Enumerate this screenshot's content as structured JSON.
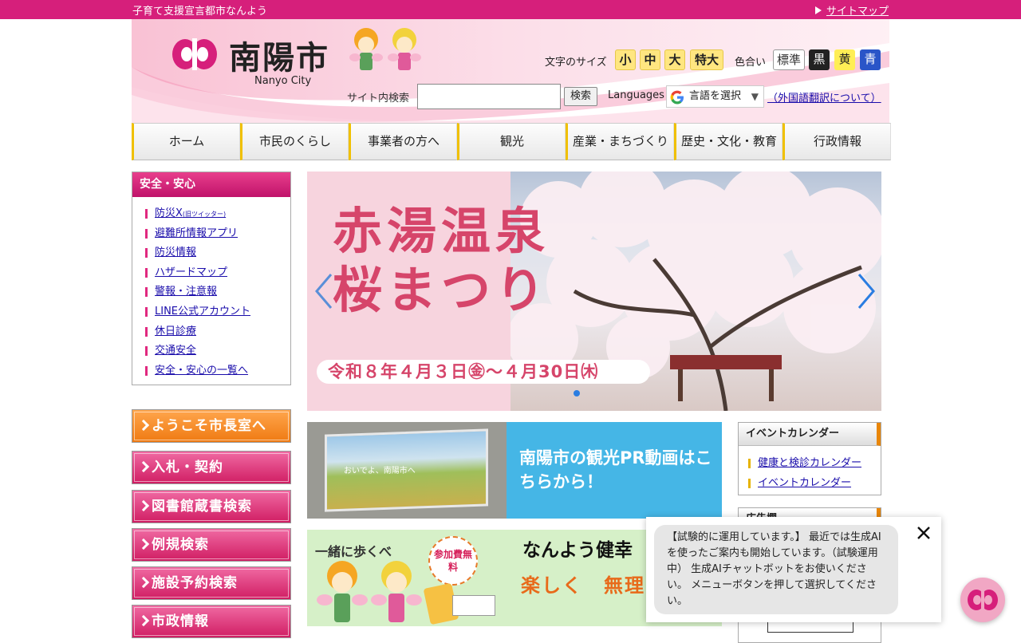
{
  "topbar": {
    "tagline": "子育て支援宣言都市なんよう",
    "sitemap": "サイトマップ"
  },
  "header": {
    "logo_jp": "南陽市",
    "logo_en": "Nanyo City",
    "text_size_label": "文字のサイズ",
    "text_sizes": [
      "小",
      "中",
      "大",
      "特大"
    ],
    "color_label": "色合い",
    "color_options": [
      {
        "label": "標準",
        "bg": "#ffffff",
        "fg": "#333333"
      },
      {
        "label": "黒",
        "bg": "#222222",
        "fg": "#ffffff"
      },
      {
        "label": "黄",
        "bg": "#ffee55",
        "fg": "#222222"
      },
      {
        "label": "青",
        "bg": "#2a55c8",
        "fg": "#ffffff"
      }
    ],
    "search_label": "サイト内検索",
    "search_placeholder": "",
    "search_button": "検索",
    "languages_label": "Languages",
    "language_select": "言語を選択",
    "translation_link": "（外国語翻訳について）"
  },
  "nav": [
    "ホーム",
    "市民のくらし",
    "事業者の方へ",
    "観光",
    "産業・まちづくり",
    "歴史・文化・教育",
    "行政情報"
  ],
  "sidebar": {
    "safety": {
      "title": "安全・安心",
      "items": [
        {
          "label": "防災X",
          "note": "(旧ツイッター)"
        },
        {
          "label": "避難所情報アプリ",
          "note": ""
        },
        {
          "label": "防災情報",
          "note": ""
        },
        {
          "label": "ハザードマップ",
          "note": ""
        },
        {
          "label": "警報・注意報",
          "note": ""
        },
        {
          "label": "LINE公式アカウント",
          "note": ""
        },
        {
          "label": "休日診療",
          "note": ""
        },
        {
          "label": "交通安全",
          "note": ""
        },
        {
          "label": "安全・安心の一覧へ",
          "note": ""
        }
      ]
    },
    "banners": [
      "ようこそ市長室へ",
      "入札・契約",
      "図書館蔵書検索",
      "例規検索",
      "施設予約検索",
      "市政情報"
    ]
  },
  "hero": {
    "title_line1": "赤湯温泉",
    "title_line2": "桜まつり",
    "date": "令和８年４月３日㊎～４月30日㈭"
  },
  "promo": {
    "pr_image_caption": "おいでよ、南陽市へ",
    "pr_text": "南陽市の観光PR動画はこちらから！",
    "health_left": "一緒に歩くべ",
    "health_badge": "参加費無料",
    "health_title": "なんよう健幸",
    "health_sub": "楽しく　無理"
  },
  "events": {
    "title": "イベントカレンダー",
    "items": [
      "健康と検診カレンダー",
      "イベントカレンダー"
    ]
  },
  "ads": {
    "title": "広告欄"
  },
  "chat": {
    "message": "【試験的に運用しています。】 最近では生成AIを使ったご案内も開始しています。（試験運用中） 生成AIチャットボットをお使いください。 メニューボタンを押して選択してください。"
  },
  "colors": {
    "brand_pink": "#d61f7b",
    "nav_accent": "#f0c000",
    "link": "#1a0dab"
  }
}
